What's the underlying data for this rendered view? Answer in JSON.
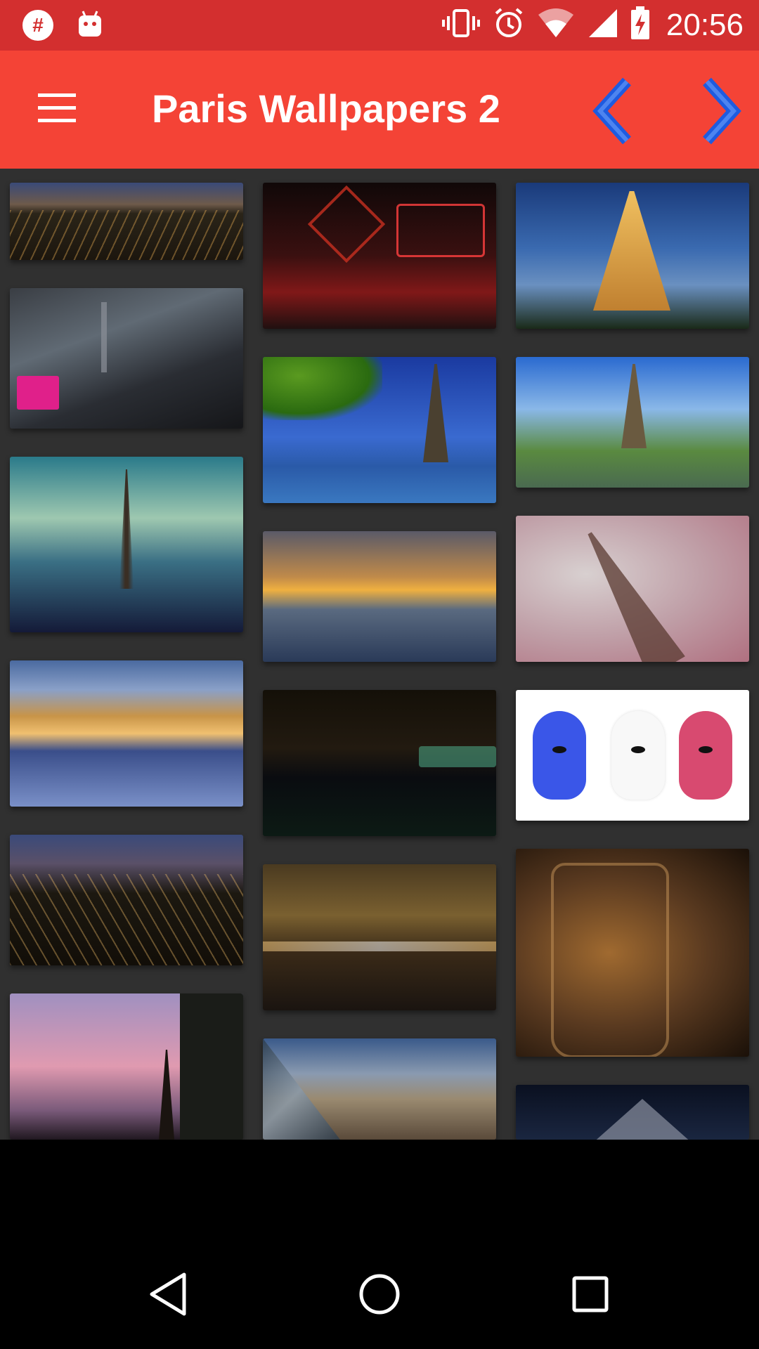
{
  "status_bar": {
    "time": "20:56",
    "icons": [
      "hash-notification-icon",
      "android-notification-icon",
      "vibrate-icon",
      "alarm-icon",
      "wifi-icon",
      "signal-icon",
      "battery-charging-icon"
    ]
  },
  "app_bar": {
    "title": "Paris Wallpapers 2",
    "menu_icon": "hamburger-menu-icon",
    "prev_icon": "chevron-left-icon",
    "next_icon": "chevron-right-icon",
    "accent_color": "#f44336",
    "status_color": "#d32f2f",
    "chevron_color": "#1e5be0"
  },
  "gallery": {
    "background": "#303030",
    "thumbnails": [
      {
        "subject": "paris-night-aerial"
      },
      {
        "subject": "moulin-rouge"
      },
      {
        "subject": "eiffel-tower-dusk"
      },
      {
        "subject": "futuristic-paris"
      },
      {
        "subject": "eiffel-seine-day"
      },
      {
        "subject": "eiffel-trocadero"
      },
      {
        "subject": "eiffel-cloudy-sky"
      },
      {
        "subject": "paris-sunset-clouds"
      },
      {
        "subject": "eiffel-miniature"
      },
      {
        "subject": "louvre-reflection"
      },
      {
        "subject": "seine-night"
      },
      {
        "subject": "balaclava-masks"
      },
      {
        "subject": "paris-night-lights"
      },
      {
        "subject": "bridge-night"
      },
      {
        "subject": "eiffel-in-jar"
      },
      {
        "subject": "eiffel-pink-sky"
      },
      {
        "subject": "louvre-palace"
      },
      {
        "subject": "louvre-pyramid-night"
      }
    ]
  },
  "nav_bar": {
    "back_icon": "back-triangle-icon",
    "home_icon": "home-circle-icon",
    "recents_icon": "recents-square-icon"
  }
}
